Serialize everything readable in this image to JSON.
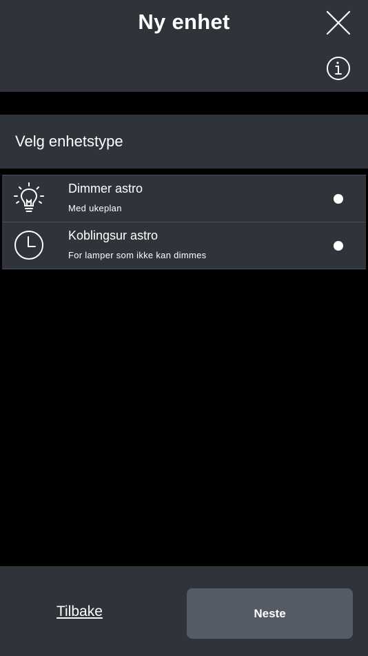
{
  "header": {
    "title": "Ny enhet",
    "close_icon": "close-icon",
    "info_icon": "info-icon"
  },
  "section": {
    "label": "Velg enhetstype"
  },
  "device_types": [
    {
      "title": "Dimmer astro",
      "subtitle": "Med ukeplan",
      "icon": "lightbulb-icon",
      "selected": false
    },
    {
      "title": "Koblingsur astro",
      "subtitle": "For lamper som ikke kan dimmes",
      "icon": "clock-icon",
      "selected": false
    }
  ],
  "footer": {
    "back_label": "Tilbake",
    "next_label": "Neste"
  },
  "colors": {
    "panel": "#2f343b",
    "background": "#000000",
    "button": "#545b66",
    "text": "#ffffff"
  }
}
